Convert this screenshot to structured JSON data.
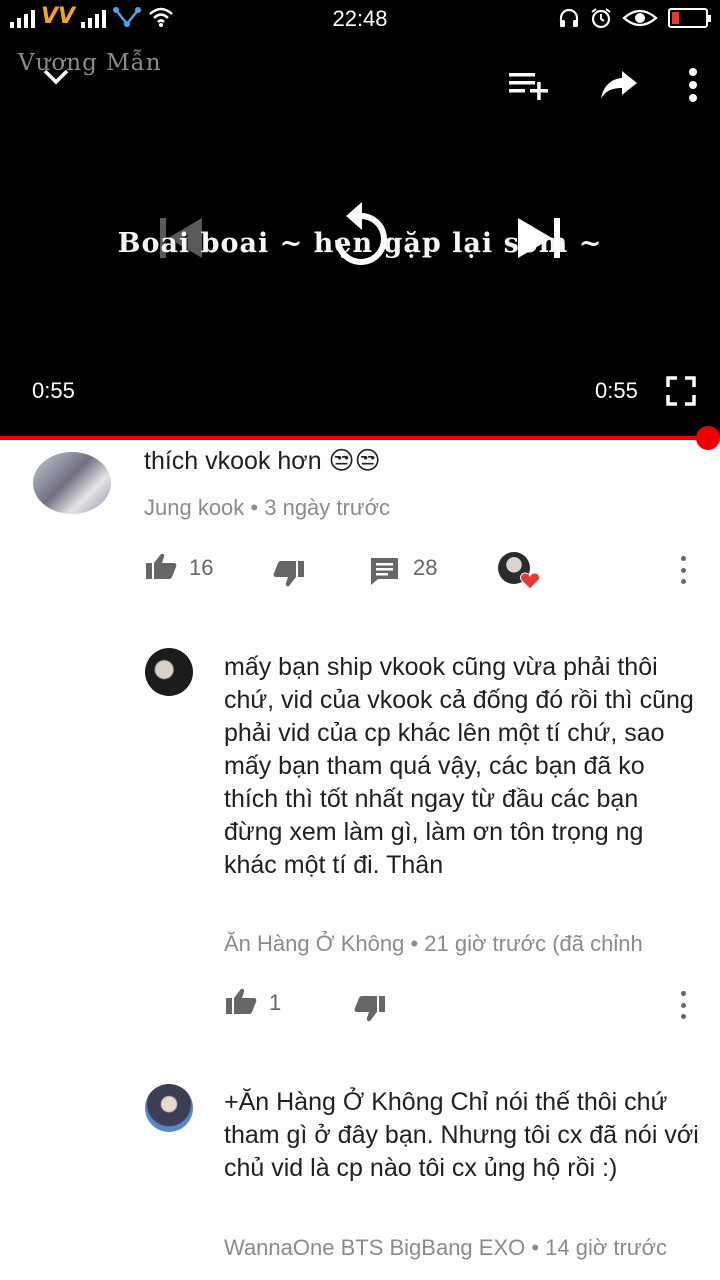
{
  "status_bar": {
    "carrier": "VV",
    "time": "22:48"
  },
  "player": {
    "watermark": "Vương Mẫn",
    "subtitle": "Boai boai ~ hẹn gặp lại sớm ~",
    "elapsed": "0:55",
    "duration": "0:55",
    "progress": 1.0
  },
  "comments": [
    {
      "text": "thích vkook hơn 😒😒",
      "author": "Jung kook",
      "time": "3 ngày trước",
      "likes": "16",
      "replies": "28"
    },
    {
      "text": "mấy bạn ship vkook cũng vừa phải thôi chứ, vid của vkook cả đống đó rồi thì cũng phải vid của cp khác lên một tí chứ, sao mấy bạn tham quá vậy, các bạn đã ko thích thì tốt nhất ngay từ đầu các bạn đừng xem làm gì, làm ơn tôn trọng ng khác một tí đi. Thân",
      "author": "Ăn Hàng Ở Không",
      "time": "21 giờ trước (đã chỉnh",
      "likes": "1"
    },
    {
      "text": "+Ăn Hàng Ở Không Chỉ nói thế thôi chứ tham gì ở đây bạn. Nhưng tôi cx đã nói với chủ vid là cp nào tôi cx ủng hộ rồi :)",
      "author": "WannaOne BTS BigBang EXO",
      "time": "14 giờ trước"
    }
  ],
  "colors": {
    "accent": "#ee0000",
    "meta_text": "#8c8c8c",
    "heart": "#e53935",
    "carrier": "#f6a21b"
  }
}
